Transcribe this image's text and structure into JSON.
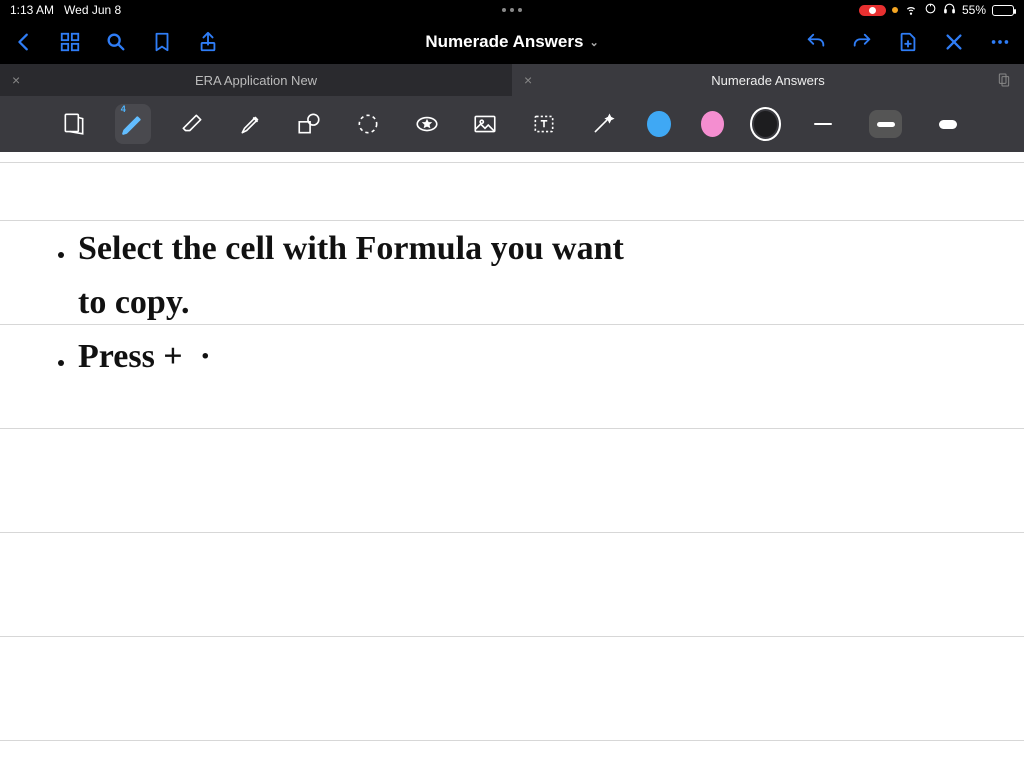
{
  "status": {
    "time": "1:13 AM",
    "date": "Wed Jun 8",
    "battery_pct": "55%"
  },
  "appbar": {
    "title": "Numerade Answers"
  },
  "tabs": [
    {
      "label": "ERA Application New",
      "active": false
    },
    {
      "label": "Numerade Answers",
      "active": true
    }
  ],
  "tools": {
    "pen_badge": "4"
  },
  "colors": {
    "blue": "#3fa8f4",
    "pink": "#f48ed0",
    "black": "#1d1d1f"
  },
  "notes": {
    "line1a": "Select the cell with Formula you want",
    "line1b": "to copy.",
    "line2": "Press +  ·"
  }
}
